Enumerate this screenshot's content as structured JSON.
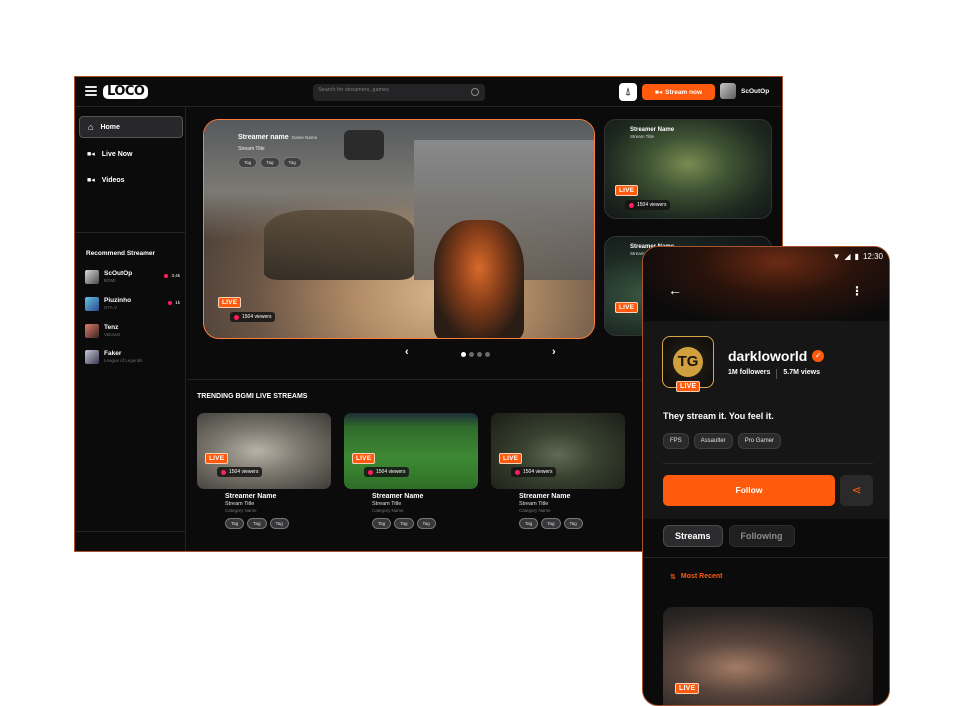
{
  "desktop": {
    "logo": "LOCO",
    "search": {
      "placeholder": "Search for streamers, games"
    },
    "stream_now": "Stream now",
    "user_name": "ScOutOp",
    "nav": [
      {
        "label": "Home",
        "icon": "home-icon",
        "active": true
      },
      {
        "label": "Live Now",
        "icon": "live-icon"
      },
      {
        "label": "Videos",
        "icon": "video-icon"
      }
    ],
    "recommend_title": "Recommend Streamer",
    "recommended": [
      {
        "name": "ScOutOp",
        "game": "BGMI",
        "count": "3.4k"
      },
      {
        "name": "Piuzinho",
        "game": "GTA V",
        "count": "1k"
      },
      {
        "name": "Tenz",
        "game": "Valorant",
        "count": ""
      },
      {
        "name": "Faker",
        "game": "League of Legends",
        "count": ""
      }
    ],
    "hero": {
      "streamer_name": "Streamer name",
      "game_name": "Game Name",
      "stream_title": "Stream Title",
      "tags": [
        "Tag",
        "Tag",
        "Tag"
      ],
      "live": "LIVE",
      "viewers": "1504 viewers"
    },
    "side_cards": [
      {
        "streamer_name": "Streamer Name",
        "stream_title": "Stream Title",
        "live": "LIVE",
        "viewers": "1504 viewers"
      },
      {
        "streamer_name": "Streamer Name",
        "stream_title": "Stream Title",
        "live": "LIVE",
        "viewers": ""
      }
    ],
    "pager": {
      "prev": "‹",
      "next": "›",
      "pages": 4,
      "current": 1
    },
    "trending_title": "TRENDING BGMI LIVE STREAMS",
    "trending": [
      {
        "streamer_name": "Streamer Name",
        "stream_title": "Stream Title",
        "category": "Category Name",
        "tags": [
          "Tag",
          "Tag",
          "Tag"
        ],
        "live": "LIVE",
        "viewers": "1504 viewers"
      },
      {
        "streamer_name": "Streamer Name",
        "stream_title": "Stream Title",
        "category": "Category Name",
        "tags": [
          "Tag",
          "Tag",
          "Tag"
        ],
        "live": "LIVE",
        "viewers": "1504 viewers"
      },
      {
        "streamer_name": "Streamer Name",
        "stream_title": "Stream Title",
        "category": "Category Name",
        "tags": [
          "Tag",
          "Tag",
          "Tag"
        ],
        "live": "LIVE",
        "viewers": "1504 viewers"
      }
    ]
  },
  "mobile": {
    "status_time": "12:30",
    "channel_name": "darkloworld",
    "followers": "1M followers",
    "views": "5.7M views",
    "live": "LIVE",
    "tagline": "They stream it. You feel it.",
    "tags": [
      "FPS",
      "Assaulter",
      "Pro Gamer"
    ],
    "follow": "Follow",
    "tabs": [
      "Streams",
      "Following"
    ],
    "sort_label": "Most Recent",
    "card_live": "LIVE"
  },
  "colors": {
    "accent": "#ff5a0d",
    "live_dot": "#ff1f5a",
    "background": "#0b0b0c",
    "frame_border": "#a8532c"
  }
}
